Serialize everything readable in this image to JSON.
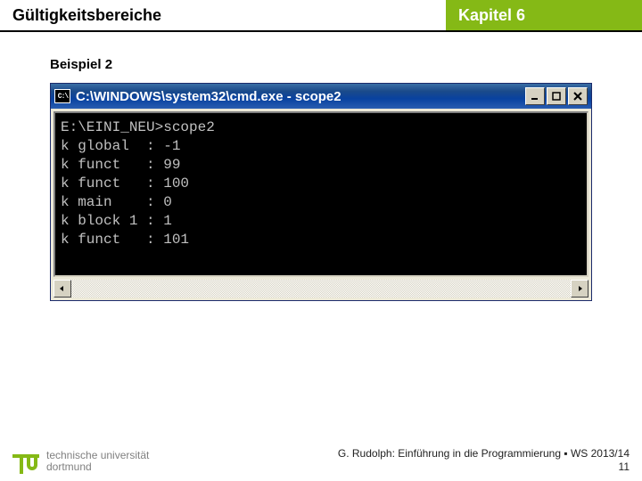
{
  "header": {
    "left": "Gültigkeitsbereiche",
    "right": "Kapitel 6"
  },
  "subtitle": "Beispiel 2",
  "window": {
    "sysicon_label": "C:\\",
    "title": "C:\\WINDOWS\\system32\\cmd.exe - scope2",
    "buttons": {
      "minimize": "minimize-button",
      "maximize": "maximize-button",
      "close": "close-button"
    }
  },
  "console_output": "E:\\EINI_NEU>scope2\nk global  : -1\nk funct   : 99\nk funct   : 100\nk main    : 0\nk block 1 : 1\nk funct   : 101",
  "footer": {
    "uni_line1": "technische universität",
    "uni_line2": "dortmund",
    "credit": "G. Rudolph: Einführung in die Programmierung ▪ WS 2013/14",
    "page": "11"
  }
}
